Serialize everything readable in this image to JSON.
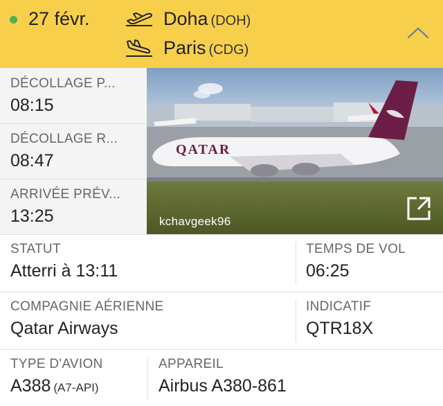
{
  "header": {
    "status_color": "#4cb24c",
    "date": "27 févr.",
    "departure_icon": "plane-takeoff-icon",
    "arrival_icon": "plane-landing-icon",
    "from_city": "Doha",
    "from_code": "(DOH)",
    "to_city": "Paris",
    "to_code": "(CDG)",
    "collapse_icon": "chevron-up-icon",
    "background": "#f7cf4b"
  },
  "times": {
    "scheduled_takeoff_label": "DÉCOLLAGE P...",
    "scheduled_takeoff": "08:15",
    "actual_takeoff_label": "DÉCOLLAGE R...",
    "actual_takeoff": "08:47",
    "scheduled_arrival_label": "ARRIVÉE PRÉV...",
    "scheduled_arrival": "13:25"
  },
  "photo": {
    "credit": "kchavgeek96",
    "open_icon": "external-link-icon"
  },
  "details": {
    "status_label": "STATUT",
    "status": "Atterri à 13:11",
    "flight_time_label": "TEMPS DE VOL",
    "flight_time": "06:25",
    "airline_label": "COMPAGNIE AÉRIENNE",
    "airline": "Qatar Airways",
    "callsign_label": "INDICATIF",
    "callsign": "QTR18X",
    "aircraft_type_label": "TYPE D'AVION",
    "aircraft_type": "A388",
    "registration": "(A7-API)",
    "aircraft_label": "APPAREIL",
    "aircraft": "Airbus A380-861"
  }
}
